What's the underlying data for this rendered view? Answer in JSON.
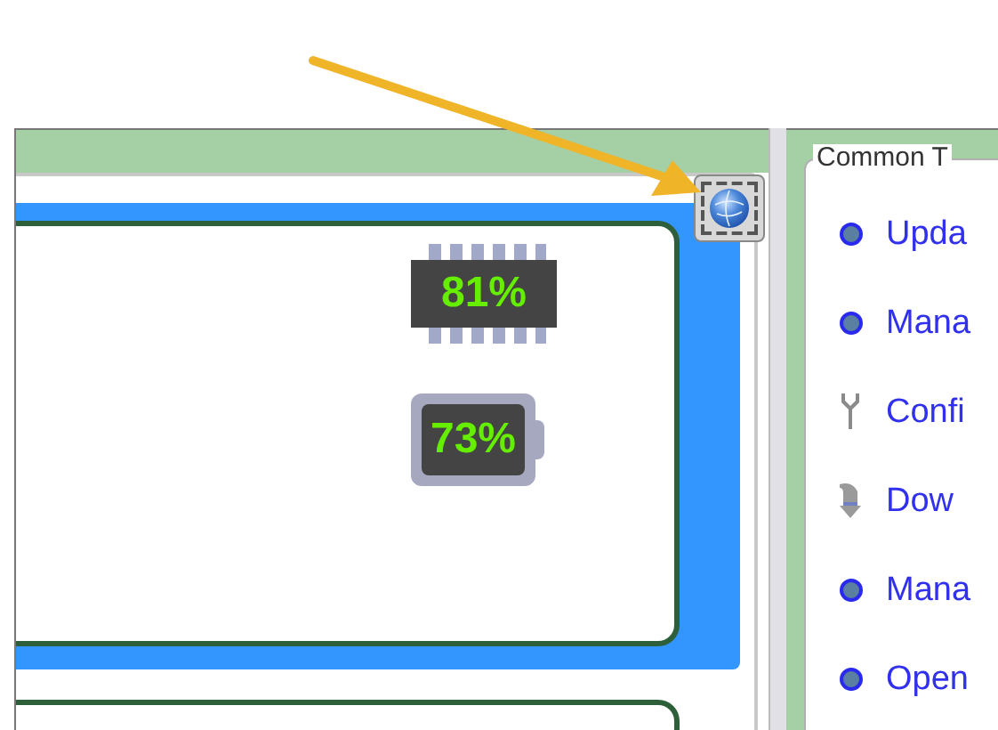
{
  "monitor": {
    "cpu_reading": "81%",
    "battery_reading": "73%"
  },
  "common_tasks": {
    "title": "Common T",
    "items": [
      {
        "kind": "dot",
        "label": "Upda"
      },
      {
        "kind": "dot",
        "label": "Mana"
      },
      {
        "kind": "wrench",
        "label": "Confi"
      },
      {
        "kind": "download",
        "label": "Dow"
      },
      {
        "kind": "dot",
        "label": "Mana"
      },
      {
        "kind": "dot",
        "label": "Open"
      }
    ]
  }
}
